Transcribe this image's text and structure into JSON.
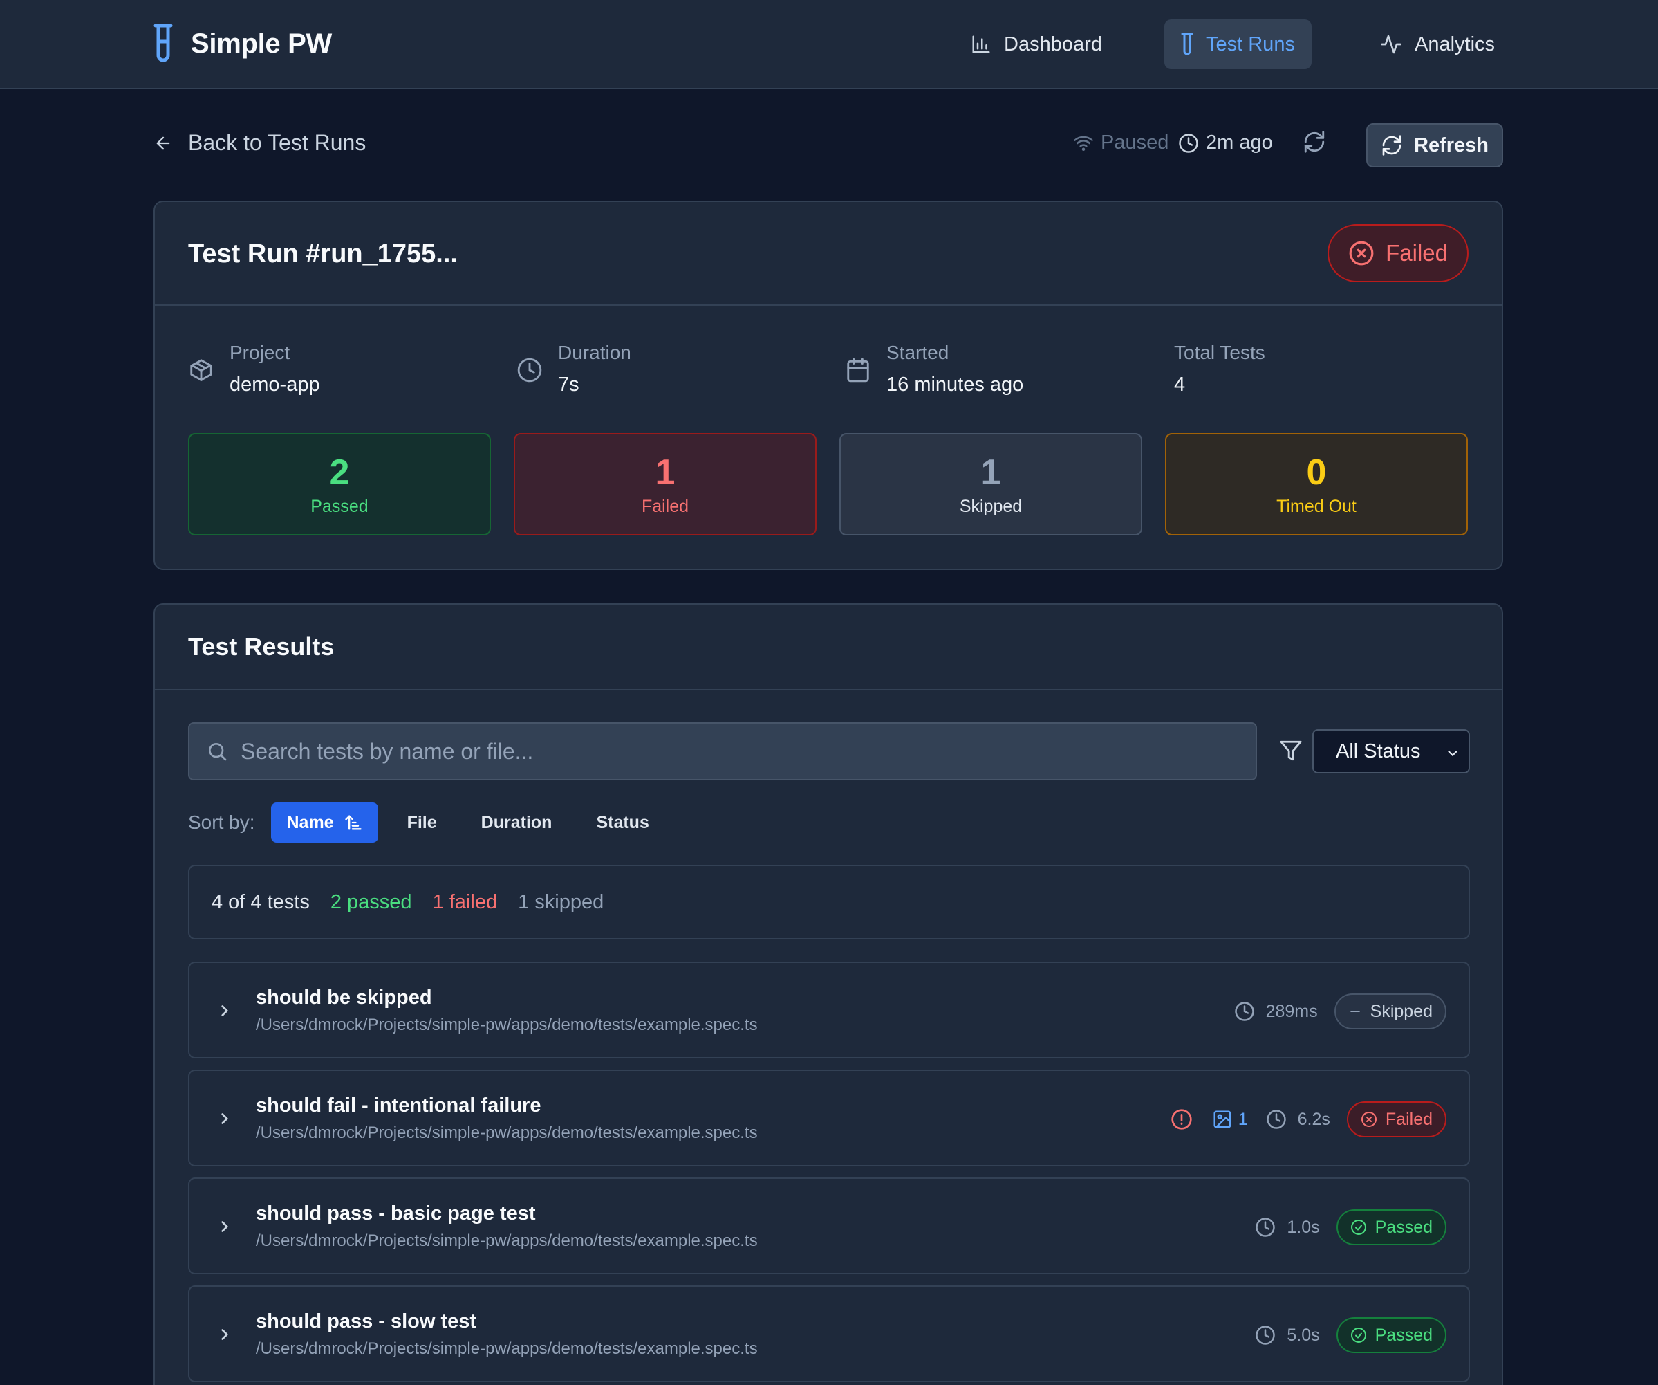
{
  "app": {
    "name": "Simple PW"
  },
  "nav": [
    {
      "label": "Dashboard",
      "icon": "bar-chart-icon",
      "active": false
    },
    {
      "label": "Test Runs",
      "icon": "test-tube-icon",
      "active": true
    },
    {
      "label": "Analytics",
      "icon": "activity-icon",
      "active": false
    }
  ],
  "toolbar": {
    "back_label": "Back to Test Runs",
    "live_status": "Paused",
    "last_updated": "2m ago",
    "refresh_label": "Refresh"
  },
  "run": {
    "title": "Test Run #run_1755...",
    "status": "Failed",
    "info": [
      {
        "label": "Project",
        "value": "demo-app",
        "icon": "package-icon"
      },
      {
        "label": "Duration",
        "value": "7s",
        "icon": "clock-icon"
      },
      {
        "label": "Started",
        "value": "16 minutes ago",
        "icon": "calendar-icon"
      },
      {
        "label": "Total Tests",
        "value": "4",
        "icon": ""
      }
    ],
    "stats": [
      {
        "value": "2",
        "label": "Passed"
      },
      {
        "value": "1",
        "label": "Failed"
      },
      {
        "value": "1",
        "label": "Skipped"
      },
      {
        "value": "0",
        "label": "Timed Out"
      }
    ]
  },
  "results": {
    "title": "Test Results",
    "search_placeholder": "Search tests by name or file...",
    "status_filter": "All Status",
    "sort_label": "Sort by:",
    "sort_options": [
      "Name",
      "File",
      "Duration",
      "Status"
    ],
    "sort_active": "Name",
    "summary": {
      "total": "4 of 4 tests",
      "passed": "2 passed",
      "failed": "1 failed",
      "skipped": "1 skipped"
    },
    "tests": [
      {
        "name": "should be skipped",
        "file": "/Users/dmrock/Projects/simple-pw/apps/demo/tests/example.spec.ts",
        "duration": "289ms",
        "status": "Skipped",
        "has_error": false,
        "screenshots": ""
      },
      {
        "name": "should fail - intentional failure",
        "file": "/Users/dmrock/Projects/simple-pw/apps/demo/tests/example.spec.ts",
        "duration": "6.2s",
        "status": "Failed",
        "has_error": true,
        "screenshots": "1"
      },
      {
        "name": "should pass - basic page test",
        "file": "/Users/dmrock/Projects/simple-pw/apps/demo/tests/example.spec.ts",
        "duration": "1.0s",
        "status": "Passed",
        "has_error": false,
        "screenshots": ""
      },
      {
        "name": "should pass - slow test",
        "file": "/Users/dmrock/Projects/simple-pw/apps/demo/tests/example.spec.ts",
        "duration": "5.0s",
        "status": "Passed",
        "has_error": false,
        "screenshots": ""
      }
    ]
  },
  "colors": {
    "background": "#0f172a",
    "surface": "#1e293b",
    "accent": "#2563eb",
    "passed": "#4ade80",
    "failed": "#f87171",
    "timed_out": "#facc15"
  }
}
